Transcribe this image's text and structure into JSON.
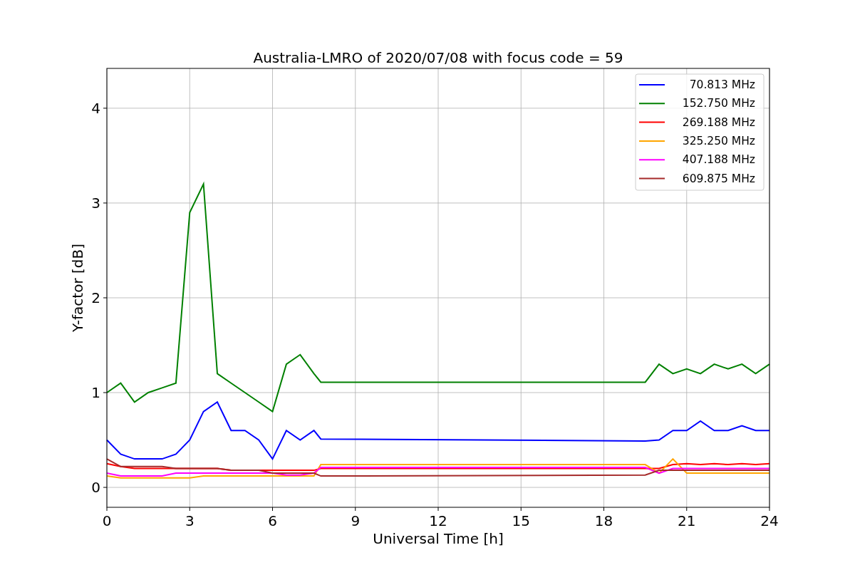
{
  "plot": {
    "chart_data": {
      "type": "line",
      "title": "Australia-LMRO of 2020/07/08 with focus code = 59",
      "xlabel": "Universal Time [h]",
      "ylabel": "Y-factor [dB]",
      "x": [
        0,
        0.5,
        1,
        1.5,
        2,
        2.5,
        3,
        3.5,
        4,
        4.5,
        5,
        5.5,
        6,
        6.5,
        7,
        7.5,
        7.75,
        19.5,
        20,
        20.5,
        21,
        21.5,
        22,
        22.5,
        23,
        23.5,
        24
      ],
      "grid": true,
      "legend": "upper right",
      "xlim": [
        0,
        24
      ],
      "ylim": [
        -0.21,
        4.42
      ],
      "xticks": [
        0,
        3,
        6,
        9,
        12,
        15,
        18,
        21,
        24
      ],
      "yticks": [
        0,
        1,
        2,
        3,
        4
      ],
      "series": [
        {
          "name": "70.813 MHz",
          "color": "#0000ff",
          "values": [
            0.5,
            0.35,
            0.3,
            0.3,
            0.3,
            0.35,
            0.5,
            0.8,
            0.9,
            0.6,
            0.6,
            0.5,
            0.3,
            0.6,
            0.5,
            0.6,
            0.51,
            0.49,
            0.5,
            0.6,
            0.6,
            0.7,
            0.6,
            0.6,
            0.65,
            0.6,
            0.6
          ]
        },
        {
          "name": "152.750 MHz",
          "color": "#008000",
          "values": [
            1.0,
            1.1,
            0.9,
            1.0,
            1.05,
            1.1,
            2.9,
            3.2,
            1.2,
            1.1,
            1.0,
            0.9,
            0.8,
            1.3,
            1.4,
            1.2,
            1.11,
            1.11,
            1.3,
            1.2,
            1.25,
            1.2,
            1.3,
            1.25,
            1.3,
            1.2,
            1.3
          ]
        },
        {
          "name": "269.188 MHz",
          "color": "#ff0000",
          "values": [
            0.25,
            0.22,
            0.2,
            0.2,
            0.2,
            0.2,
            0.2,
            0.2,
            0.2,
            0.18,
            0.18,
            0.18,
            0.18,
            0.18,
            0.18,
            0.18,
            0.2,
            0.2,
            0.2,
            0.24,
            0.25,
            0.24,
            0.25,
            0.24,
            0.25,
            0.24,
            0.25
          ]
        },
        {
          "name": "325.250 MHz",
          "color": "#ffa500",
          "values": [
            0.12,
            0.1,
            0.1,
            0.1,
            0.1,
            0.1,
            0.1,
            0.12,
            0.12,
            0.12,
            0.12,
            0.12,
            0.12,
            0.12,
            0.12,
            0.12,
            0.24,
            0.24,
            0.15,
            0.3,
            0.15,
            0.15,
            0.15,
            0.15,
            0.15,
            0.15,
            0.15
          ]
        },
        {
          "name": "407.188 MHz",
          "color": "#ff00ff",
          "values": [
            0.15,
            0.12,
            0.12,
            0.12,
            0.12,
            0.15,
            0.15,
            0.15,
            0.15,
            0.15,
            0.15,
            0.15,
            0.15,
            0.13,
            0.13,
            0.15,
            0.21,
            0.21,
            0.15,
            0.2,
            0.2,
            0.2,
            0.2,
            0.2,
            0.2,
            0.2,
            0.2
          ]
        },
        {
          "name": "609.875 MHz",
          "color": "#a52a2a",
          "values": [
            0.3,
            0.22,
            0.22,
            0.22,
            0.22,
            0.2,
            0.2,
            0.2,
            0.2,
            0.18,
            0.18,
            0.18,
            0.15,
            0.15,
            0.15,
            0.15,
            0.12,
            0.13,
            0.18,
            0.18,
            0.18,
            0.18,
            0.18,
            0.18,
            0.18,
            0.18,
            0.18
          ]
        }
      ]
    }
  }
}
